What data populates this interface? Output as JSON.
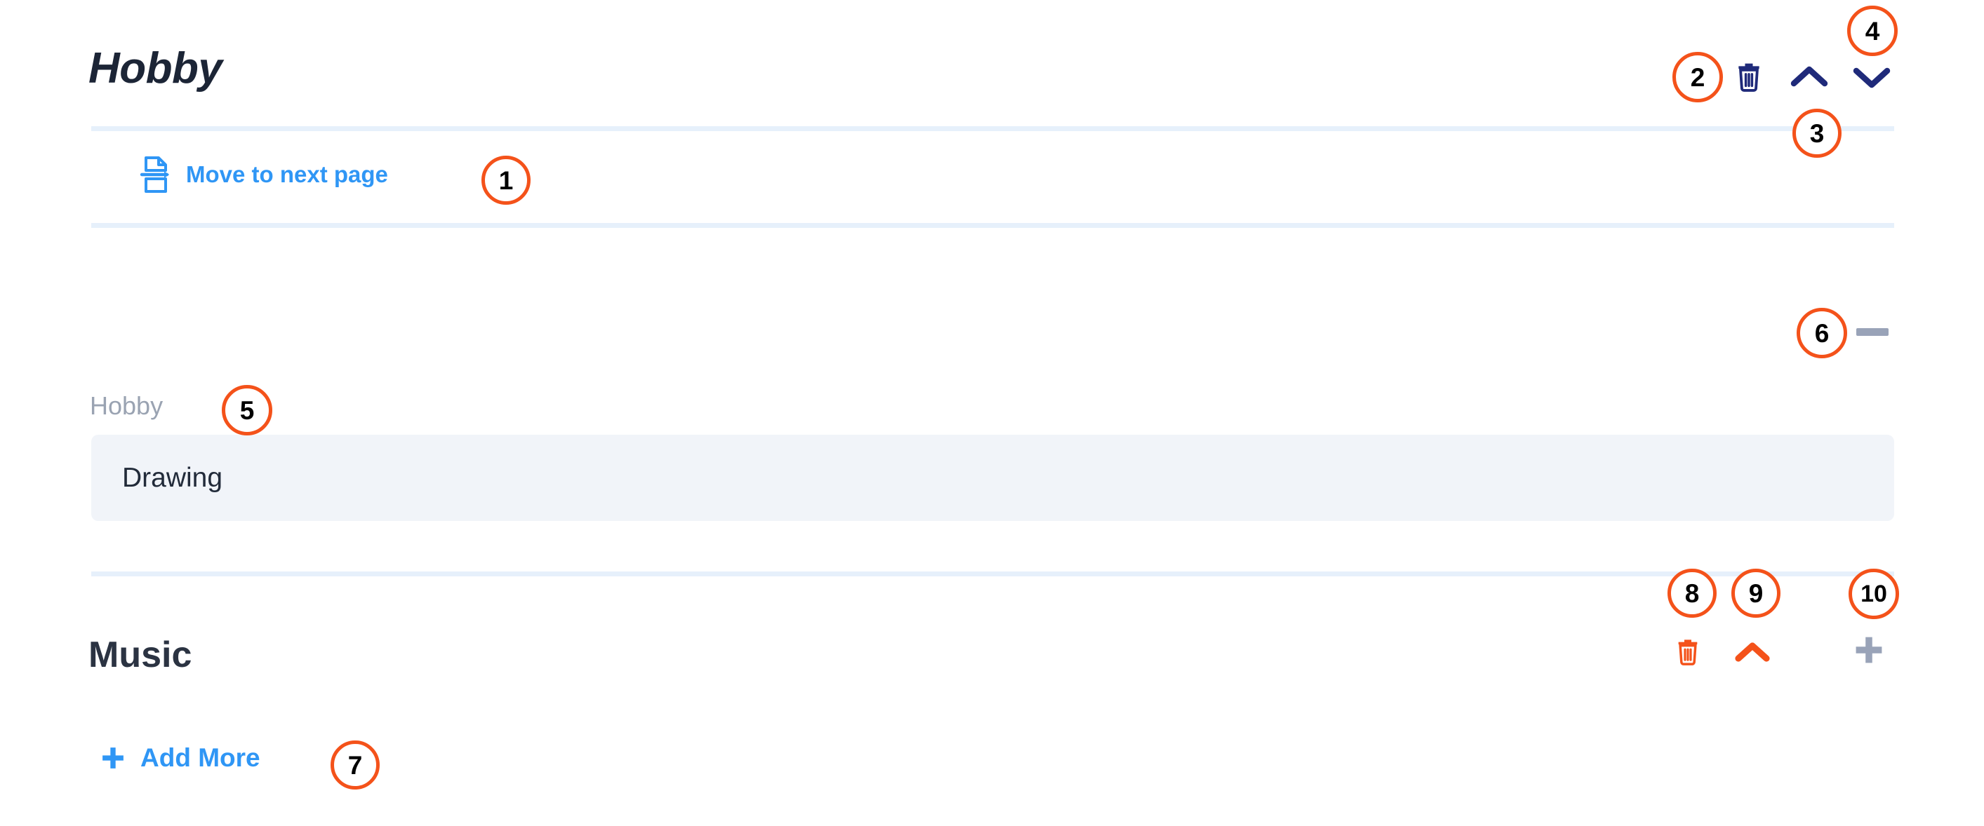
{
  "section_hobby": {
    "title": "Hobby",
    "move_next_page_label": "Move to next page",
    "field_label": "Hobby",
    "field_value": "Drawing",
    "field_placeholder": "Hobby"
  },
  "section_music": {
    "title": "Music",
    "add_more_label": "Add More"
  },
  "icons": {
    "move_next_page": "page-break-icon",
    "delete_section": "trash-icon",
    "collapse_section": "chevron-up-icon",
    "expand_section": "chevron-down-icon",
    "remove_field": "minus-icon",
    "add_more": "plus-icon",
    "music_delete": "trash-icon",
    "music_collapse": "chevron-up-icon",
    "music_add": "plus-icon"
  },
  "colors": {
    "link_blue": "#2f96f5",
    "navy_icon": "#1f2a7a",
    "orange_icon": "#f4521a",
    "gray_icon": "#99a3b8",
    "badge_border": "#f4521a",
    "divider": "#e6f0fb",
    "field_bg": "#f1f4f9",
    "label_gray": "#9aa3b2",
    "title_dark": "#1c2536"
  },
  "annotations": {
    "b1": "1",
    "b2": "2",
    "b3": "3",
    "b4": "4",
    "b5": "5",
    "b6": "6",
    "b7": "7",
    "b8": "8",
    "b9": "9",
    "b10": "10"
  }
}
